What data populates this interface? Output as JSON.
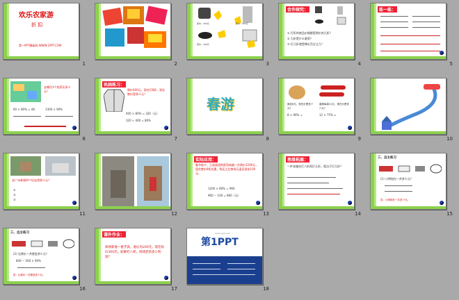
{
  "slides": [
    {
      "n": "1",
      "title": "欢乐农家游",
      "subtitle": "折 扣",
      "footer": "第一PPT模板网-WWW.1PPT.COM"
    },
    {
      "n": "2"
    },
    {
      "n": "3",
      "a": "原价：200元",
      "b": "原价：500元",
      "c": "原价：300元"
    },
    {
      "n": "4",
      "head": "合作探究：",
      "q1": "① 打折的商品价格都是原价的几折？",
      "q2": "② 九折是什么意思？",
      "q3": "③ 打几折就是降价百分之几？"
    },
    {
      "n": "5",
      "head": "练一练："
    },
    {
      "n": "6",
      "q": "去哪住3个农家乐多少元？",
      "a1": "60 × 80% = 48",
      "a2": "1300 × 90%"
    },
    {
      "n": "7",
      "head": "巩固练习：",
      "q": "原价400元，现在打8折，现在售价是多少元？",
      "a1": "400 × 80% = 320（元）",
      "a2": "320 ÷ 400 = 80%"
    },
    {
      "n": "8",
      "word": "春游"
    },
    {
      "n": "9",
      "a": "面包8元，现在价是多少元？",
      "b": "香肠每袋12元，现在价是多少元？",
      "c": "8 × 90% =",
      "d": "12 × 75% ="
    },
    {
      "n": "10"
    },
    {
      "n": "11",
      "q": "去广州参观四个纪念馆多少元？",
      "a": "①",
      "b": "②",
      "c": "③"
    },
    {
      "n": "12"
    },
    {
      "n": "13",
      "head": "实际应用：",
      "q": "春节前夕，王叔叔选购家用电器一台原价1200元，现在售价8折优惠，购买之后商场又返还现金100元。",
      "a1": "1200 × 80% = 960",
      "a2": "960 − 100 = 860（元）"
    },
    {
      "n": "14",
      "head": "思维拓展：",
      "q": "一件衣服先打八折再打九折，相当于打几折？"
    },
    {
      "n": "15",
      "head": "三、自主练习",
      "a": "(1) 小明现在一共多少元？",
      "b": "答：小明现在一共多少元。"
    },
    {
      "n": "16",
      "head": "三、自主练习",
      "a": "(2) 比原价一共便宜多少元？",
      "b": "840 − 560 × 90%",
      "c": "答：比原价一共便宜多少元。"
    },
    {
      "n": "17",
      "head": "课外作业：",
      "q": "商场新进一批学具，进价为200元，现在标价300元，如果打八折，商场还有多少利润？"
    },
    {
      "n": "18",
      "logo": "第1PPT",
      "logoTop": "www.1ppt.com"
    }
  ]
}
